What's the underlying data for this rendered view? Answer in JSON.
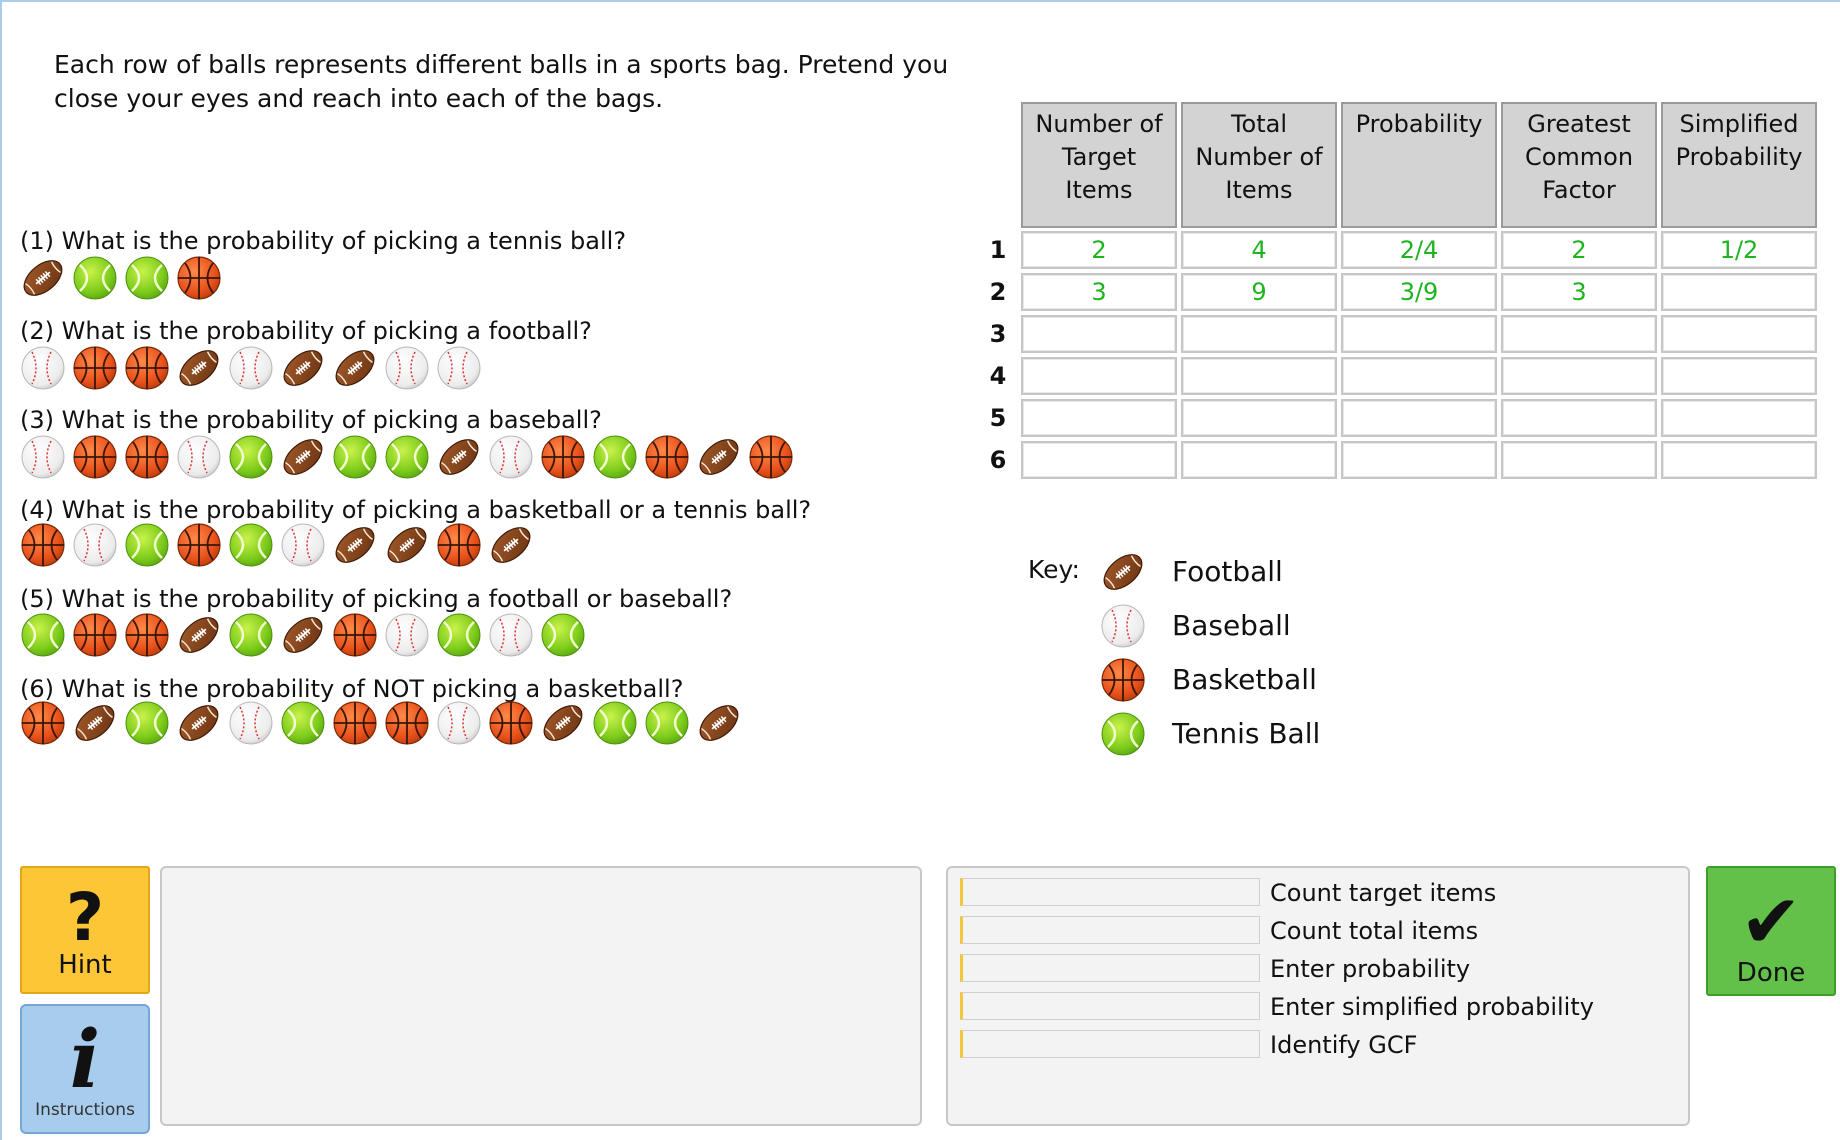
{
  "intro": "Each row of balls represents different balls in a sports bag. Pretend you close your eyes and reach into each of the bags.",
  "questions": [
    {
      "text": "(1) What is the probability of picking a tennis ball?",
      "balls": [
        "football",
        "tennis",
        "tennis",
        "basketball"
      ]
    },
    {
      "text": "(2) What is the probability of picking a football?",
      "balls": [
        "baseball",
        "basketball",
        "basketball",
        "football",
        "baseball",
        "football",
        "football",
        "baseball",
        "baseball"
      ]
    },
    {
      "text": "(3) What is the probability of picking a baseball?",
      "balls": [
        "baseball",
        "basketball",
        "basketball",
        "baseball",
        "tennis",
        "football",
        "tennis",
        "tennis",
        "football",
        "baseball",
        "basketball",
        "tennis",
        "basketball",
        "football",
        "basketball"
      ]
    },
    {
      "text": "(4) What is the probability of picking a basketball or a tennis ball?",
      "balls": [
        "basketball",
        "baseball",
        "tennis",
        "basketball",
        "tennis",
        "baseball",
        "football",
        "football",
        "basketball",
        "football"
      ]
    },
    {
      "text": "(5) What is the probability of picking a football or baseball?",
      "balls": [
        "tennis",
        "basketball",
        "basketball",
        "football",
        "tennis",
        "football",
        "basketball",
        "baseball",
        "tennis",
        "baseball",
        "tennis"
      ]
    },
    {
      "text": "(6) What is the probability of NOT picking a basketball?",
      "balls": [
        "basketball",
        "football",
        "tennis",
        "football",
        "baseball",
        "tennis",
        "basketball",
        "basketball",
        "baseball",
        "basketball",
        "football",
        "tennis",
        "tennis",
        "football"
      ]
    }
  ],
  "table": {
    "headers": [
      [
        "Number of",
        "Target",
        "Items"
      ],
      [
        "Total",
        "Number of",
        "Items"
      ],
      [
        "Probability"
      ],
      [
        "Greatest",
        "Common",
        "Factor"
      ],
      [
        "Simplified",
        "Probability"
      ]
    ],
    "row_labels": [
      "1",
      "2",
      "3",
      "4",
      "5",
      "6"
    ],
    "rows": [
      [
        "2",
        "4",
        "2/4",
        "2",
        "1/2"
      ],
      [
        "3",
        "9",
        "3/9",
        "3",
        ""
      ],
      [
        "",
        "",
        "",
        "",
        ""
      ],
      [
        "",
        "",
        "",
        "",
        ""
      ],
      [
        "",
        "",
        "",
        "",
        ""
      ],
      [
        "",
        "",
        "",
        "",
        ""
      ]
    ],
    "value_color": "#1fb31f"
  },
  "key": {
    "label": "Key:",
    "items": [
      {
        "icon": "football",
        "label": "Football"
      },
      {
        "icon": "baseball",
        "label": "Baseball"
      },
      {
        "icon": "basketball",
        "label": "Basketball"
      },
      {
        "icon": "tennis",
        "label": "Tennis Ball"
      }
    ]
  },
  "buttons": {
    "hint": "Hint",
    "instructions": "Instructions",
    "done": "Done",
    "hint_icon": "question-mark-icon",
    "instructions_icon": "info-icon",
    "done_icon": "checkmark-icon"
  },
  "progress": [
    "Count target items",
    "Count total items",
    "Enter probability",
    "Enter simplified probability",
    "Identify GCF"
  ],
  "colors": {
    "hint_bg": "#fcc636",
    "instructions_bg": "#a7ccee",
    "done_bg": "#63c14a",
    "header_bg": "#d3d3d3"
  }
}
